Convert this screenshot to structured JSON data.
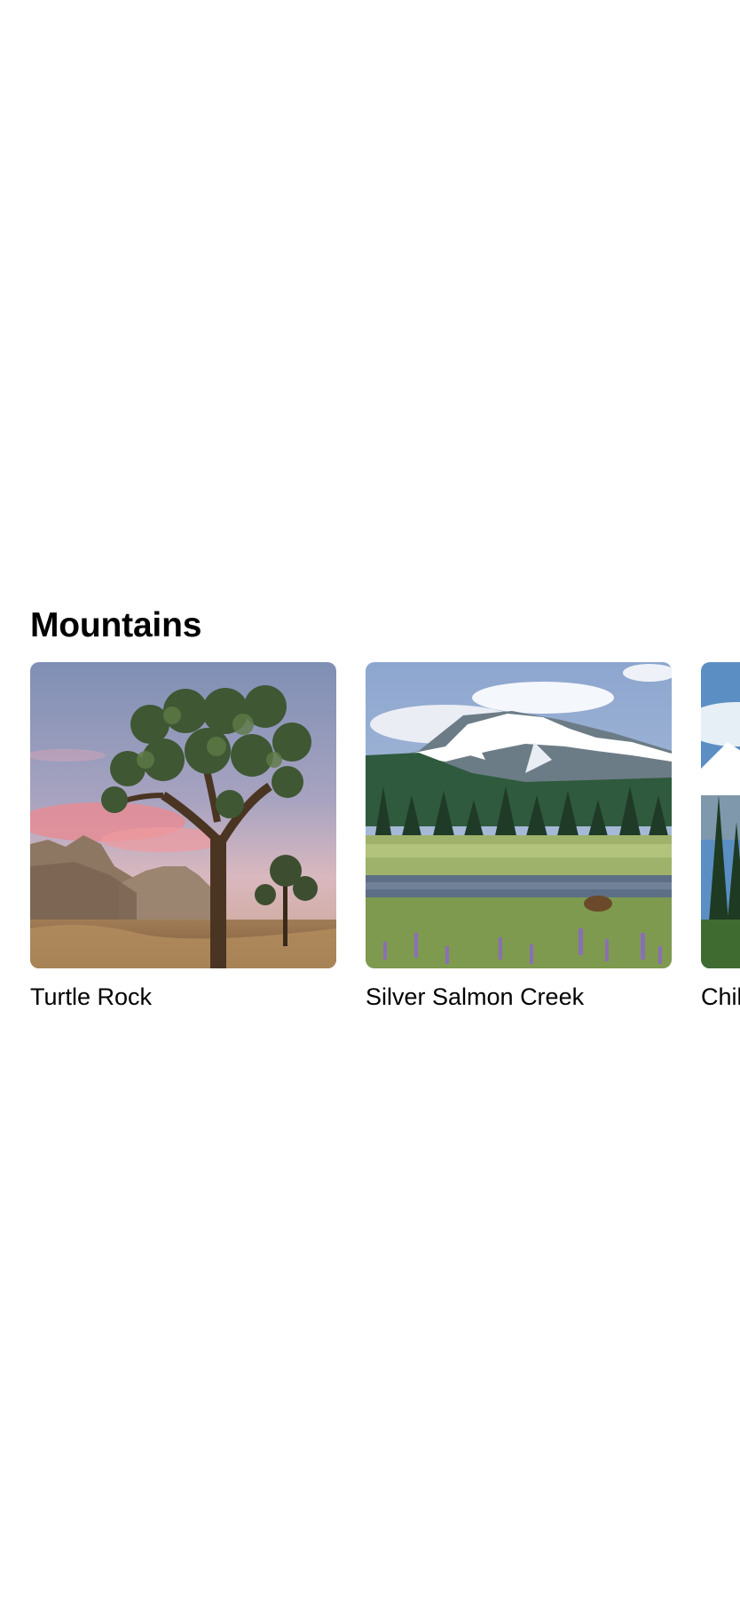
{
  "section": {
    "title": "Mountains"
  },
  "landmarks": [
    {
      "name": "Turtle Rock",
      "image": "desert-joshua-tree-photo"
    },
    {
      "name": "Silver Salmon Creek",
      "image": "snowy-mountain-meadow-photo"
    },
    {
      "name": "Chilkoot Trail",
      "image": "alpine-forest-photo"
    }
  ]
}
